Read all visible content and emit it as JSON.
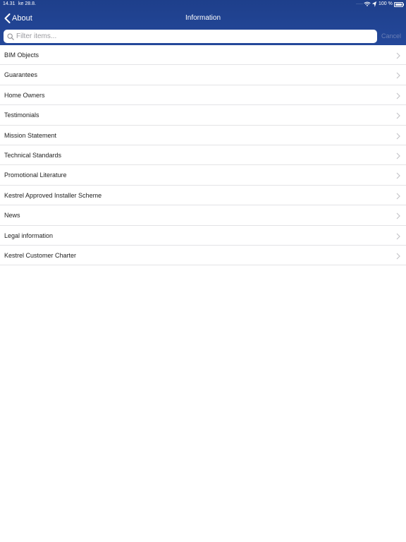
{
  "status_bar": {
    "time": "14.31",
    "date": "ke 28.8.",
    "signal": "·····",
    "battery": "100 %"
  },
  "nav": {
    "back_label": "About",
    "title": "Information"
  },
  "search": {
    "placeholder": "Filter items...",
    "value": "",
    "cancel_label": "Cancel"
  },
  "items": [
    {
      "label": "BIM Objects"
    },
    {
      "label": "Guarantees"
    },
    {
      "label": "Home Owners"
    },
    {
      "label": "Testimonials"
    },
    {
      "label": "Mission Statement"
    },
    {
      "label": "Technical Standards"
    },
    {
      "label": "Promotional Literature"
    },
    {
      "label": "Kestrel Approved Installer Scheme"
    },
    {
      "label": "News"
    },
    {
      "label": "Legal information"
    },
    {
      "label": "Kestrel Customer Charter"
    }
  ],
  "icons": {
    "back": "chevron-left-icon",
    "search": "magnifier-icon",
    "row": "chevron-right-icon",
    "wifi": "wifi-icon",
    "location": "location-arrow-icon",
    "battery": "battery-icon"
  },
  "colors": {
    "nav_bar": "#1e3f8b",
    "cancel": "#6a7fb5",
    "separator": "#e3e3e6",
    "chevron": "#c4c4c8"
  }
}
